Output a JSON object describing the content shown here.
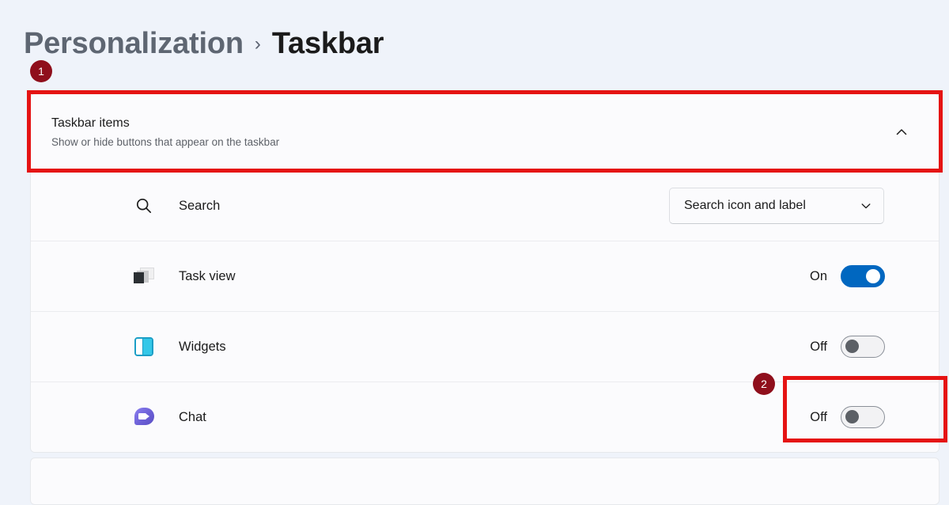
{
  "breadcrumb": {
    "parent": "Personalization",
    "separator": "›",
    "current": "Taskbar"
  },
  "annotations": [
    {
      "number": "1",
      "target": "taskbar-items-header"
    },
    {
      "number": "2",
      "target": "chat-toggle"
    }
  ],
  "colors": {
    "page_background": "#eff3fa",
    "card_background": "#fbfbfd",
    "annotation_red": "#e51313",
    "badge_red": "#8f0f1c",
    "toggle_on_blue": "#0067c0",
    "widgets_icon_cyan": "#33c7e8",
    "chat_icon_purple": "#6b5fd6"
  },
  "card": {
    "title": "Taskbar items",
    "subtitle": "Show or hide buttons that appear on the taskbar",
    "collapse_icon": "chevron-up-icon",
    "rows": [
      {
        "icon": "search-icon",
        "label": "Search",
        "control": "dropdown",
        "value": "Search icon and label",
        "dropdown_icon": "chevron-down-icon"
      },
      {
        "icon": "task-view-icon",
        "label": "Task view",
        "control": "toggle",
        "state": "On"
      },
      {
        "icon": "widgets-icon",
        "label": "Widgets",
        "control": "toggle",
        "state": "Off"
      },
      {
        "icon": "chat-icon",
        "label": "Chat",
        "control": "toggle",
        "state": "Off"
      }
    ]
  }
}
